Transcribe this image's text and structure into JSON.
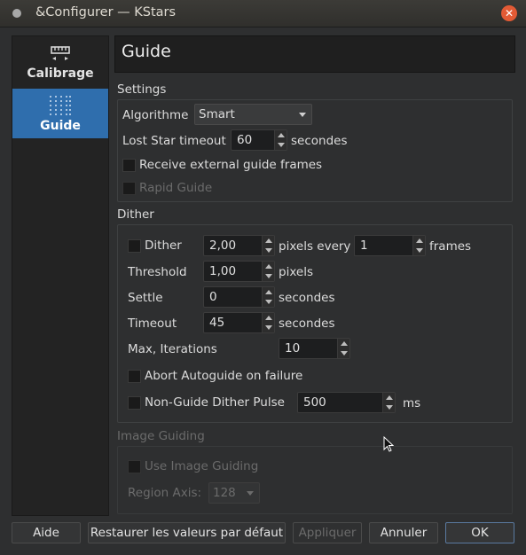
{
  "window": {
    "title": "&Configurer — KStars"
  },
  "sidebar": {
    "items": [
      {
        "label": "Calibrage",
        "icon": "calibration-ruler-icon"
      },
      {
        "label": "Guide",
        "icon": "guide-grid-icon"
      }
    ]
  },
  "page": {
    "title": "Guide"
  },
  "settings": {
    "group_title": "Settings",
    "algorithm_label": "Algorithme",
    "algorithm_value": "Smart",
    "lost_star_label": "Lost Star timeout",
    "lost_star_value": "60",
    "lost_star_unit": "secondes",
    "receive_external_label": "Receive external guide frames",
    "rapid_guide_label": "Rapid Guide"
  },
  "dither": {
    "group_title": "Dither",
    "dither_label": "Dither",
    "dither_value": "2,00",
    "pixels_every_label": "pixels every",
    "frames_value": "1",
    "frames_label": "frames",
    "threshold_label": "Threshold",
    "threshold_value": "1,00",
    "threshold_unit": "pixels",
    "settle_label": "Settle",
    "settle_value": "0",
    "settle_unit": "secondes",
    "timeout_label": "Timeout",
    "timeout_value": "45",
    "timeout_unit": "secondes",
    "max_iter_label": "Max, Iterations",
    "max_iter_value": "10",
    "abort_label": "Abort Autoguide on failure",
    "non_guide_label": "Non-Guide Dither Pulse",
    "non_guide_value": "500",
    "non_guide_unit": "ms"
  },
  "image_guiding": {
    "group_title": "Image Guiding",
    "use_label": "Use Image Guiding",
    "region_label": "Region Axis:",
    "region_value": "128"
  },
  "buttons": {
    "help": "Aide",
    "restore": "Restaurer les valeurs par défaut",
    "apply": "Appliquer",
    "cancel": "Annuler",
    "ok": "OK"
  }
}
